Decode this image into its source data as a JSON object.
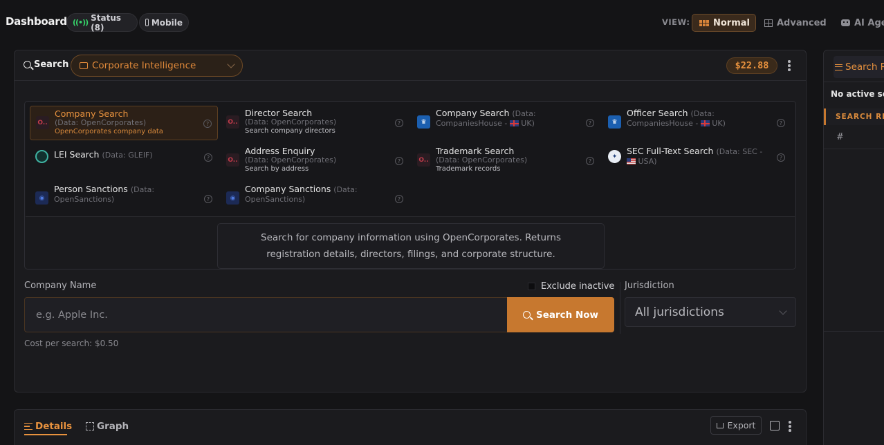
{
  "header": {
    "title": "Dashboard",
    "status_label": "Status (8)",
    "mobile_label": "Mobile",
    "view_label": "VIEW:",
    "view_modes": [
      "Normal",
      "Advanced",
      "AI Age"
    ],
    "active_view": "Normal"
  },
  "search_panel": {
    "search_label": "Search",
    "category": "Corporate Intelligence",
    "credit_balance": "$22.88",
    "sources": [
      {
        "title": "Company Search",
        "meta": "(Data: OpenCorporates)",
        "desc": "OpenCorporates company data",
        "icon": "opencorporates-icon",
        "active": true
      },
      {
        "title": "Director Search",
        "meta": "(Data: OpenCorporates)",
        "desc": "Search company directors",
        "icon": "opencorporates-icon",
        "active": false
      },
      {
        "title": "Company Search",
        "meta": "(Data: CompaniesHouse - ",
        "meta_suffix": " UK)",
        "desc": "",
        "icon": "companies-house-icon",
        "active": false
      },
      {
        "title": "Officer Search",
        "meta": "(Data: CompaniesHouse - ",
        "meta_suffix": " UK)",
        "desc": "",
        "icon": "companies-house-icon",
        "active": false
      },
      {
        "title": "LEI Search",
        "meta": "(Data: GLEIF)",
        "desc": "",
        "icon": "gleif-icon",
        "active": false
      },
      {
        "title": "Address Enquiry",
        "meta": "(Data: OpenCorporates)",
        "desc": "Search by address",
        "icon": "opencorporates-icon",
        "active": false
      },
      {
        "title": "Trademark Search",
        "meta": "(Data: OpenCorporates)",
        "desc": "Trademark records",
        "icon": "opencorporates-icon",
        "active": false
      },
      {
        "title": "SEC Full-Text Search",
        "meta": "(Data: SEC - ",
        "meta_suffix": " USA)",
        "desc": "",
        "icon": "sec-seal-icon",
        "active": false
      },
      {
        "title": "Person Sanctions",
        "meta": "(Data: OpenSanctions)",
        "desc": "",
        "icon": "opensanctions-icon",
        "active": false
      },
      {
        "title": "Company Sanctions",
        "meta": "(Data: OpenSanctions)",
        "desc": "",
        "icon": "opensanctions-icon",
        "active": false
      }
    ],
    "description_line1": "Search for company information using OpenCorporates. Returns",
    "description_line2": "registration details, directors, filings, and corporate structure.",
    "company_name_label": "Company Name",
    "company_name_placeholder": "e.g. Apple Inc.",
    "exclude_inactive_label": "Exclude inactive",
    "search_button": "Search Now",
    "jurisdiction_label": "Jurisdiction",
    "jurisdiction_value": "All jurisdictions",
    "cost_text": "Cost per search: $0.50"
  },
  "results_panel": {
    "tabs": [
      "Details",
      "Graph"
    ],
    "export_label": "Export"
  },
  "right_panel": {
    "title": "Search R",
    "no_active": "No active sec",
    "tab_label": "SEARCH RES",
    "column_hash": "#"
  },
  "colors": {
    "accent": "#e8923e",
    "button": "#c7782f",
    "background": "#141416",
    "status_green": "#36d36a"
  }
}
